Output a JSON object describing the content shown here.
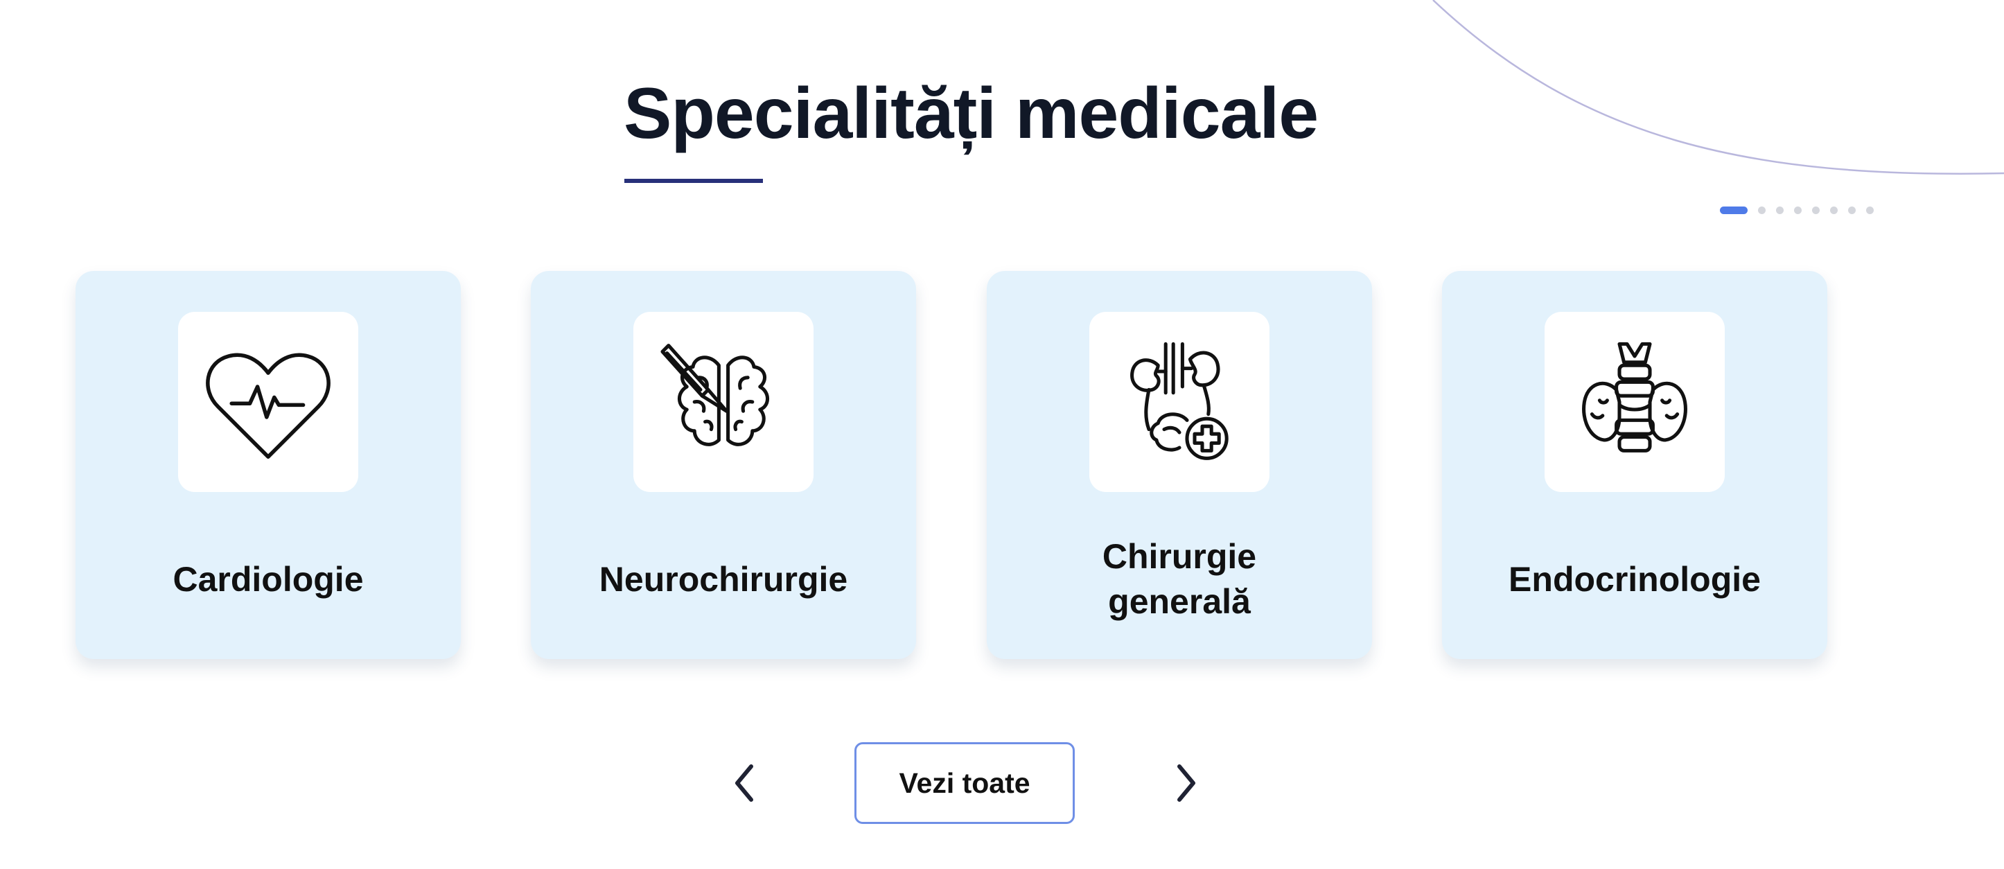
{
  "section": {
    "title": "Specialități medicale"
  },
  "pagination": {
    "total": 8,
    "active_index": 0
  },
  "cards": [
    {
      "label": "Cardiologie",
      "icon": "heart-pulse-icon"
    },
    {
      "label": "Neurochirurgie",
      "icon": "brain-scalpel-icon"
    },
    {
      "label": "Chirurgie generală",
      "icon": "organs-plus-icon"
    },
    {
      "label": "Endocrinologie",
      "icon": "thyroid-icon"
    }
  ],
  "controls": {
    "view_all_label": "Vezi toate",
    "prev_icon": "chevron-left-icon",
    "next_icon": "chevron-right-icon"
  },
  "colors": {
    "title": "#111827",
    "title_underline": "#28307a",
    "card_background": "#e3f2fc",
    "active_dot": "#4f7be8",
    "inactive_dot": "#d4d6dc",
    "button_border": "#6f8fe6",
    "decorative_arc": "#b9b7dd"
  }
}
